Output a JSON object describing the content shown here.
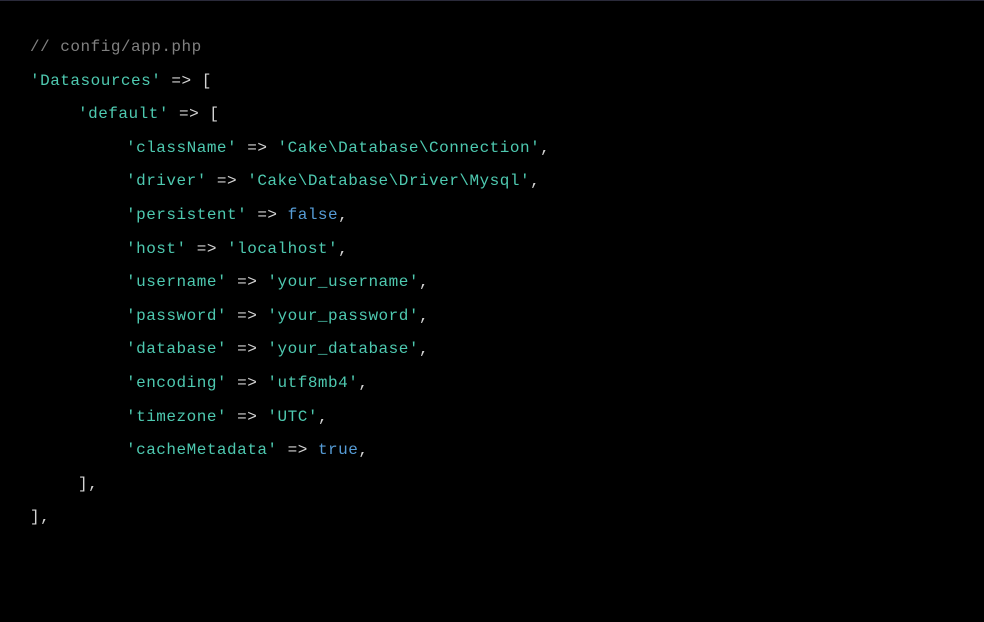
{
  "code": {
    "comment": "// config/app.php",
    "blank": "",
    "datasources_key": "'Datasources'",
    "arrow": " => ",
    "bracket_open": "[",
    "bracket_close": "]",
    "bracket_close_comma": "],",
    "default_key": "'default'",
    "className_key": "'className'",
    "className_val": "'Cake\\Database\\Connection'",
    "driver_key": "'driver'",
    "driver_val": "'Cake\\Database\\Driver\\Mysql'",
    "persistent_key": "'persistent'",
    "persistent_val": "false",
    "host_key": "'host'",
    "host_val": "'localhost'",
    "username_key": "'username'",
    "username_val": "'your_username'",
    "password_key": "'password'",
    "password_val": "'your_password'",
    "database_key": "'database'",
    "database_val": "'your_database'",
    "encoding_key": "'encoding'",
    "encoding_val": "'utf8mb4'",
    "timezone_key": "'timezone'",
    "timezone_val": "'UTC'",
    "cacheMetadata_key": "'cacheMetadata'",
    "cacheMetadata_val": "true",
    "comma": ","
  }
}
